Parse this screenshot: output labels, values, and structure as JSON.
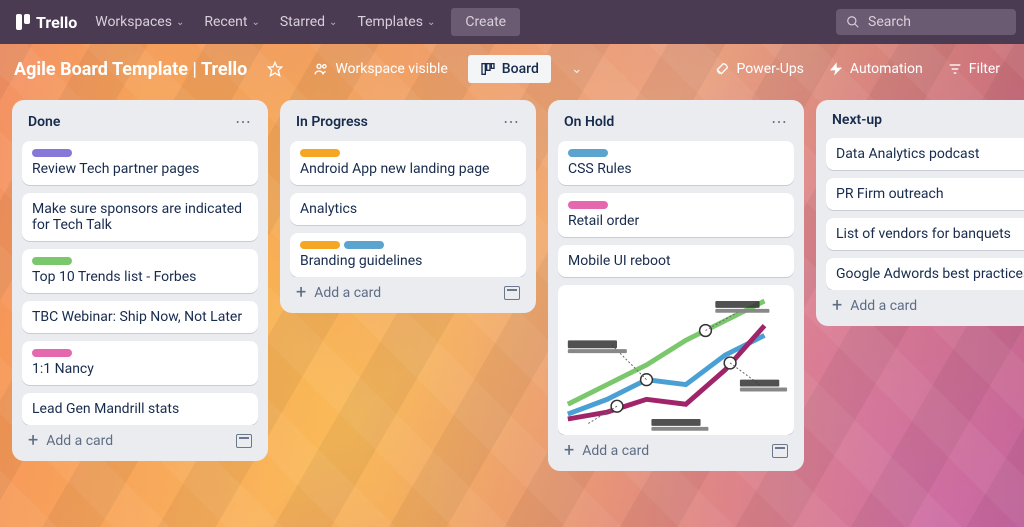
{
  "app": {
    "name": "Trello"
  },
  "topnav": {
    "items": [
      "Workspaces",
      "Recent",
      "Starred",
      "Templates"
    ],
    "create": "Create",
    "search_placeholder": "Search"
  },
  "board": {
    "title": "Agile Board Template | Trello",
    "visibility": "Workspace visible",
    "view_label": "Board",
    "actions": {
      "powerups": "Power-Ups",
      "automation": "Automation",
      "filter": "Filter"
    }
  },
  "lists": [
    {
      "title": "Done",
      "cards": [
        {
          "labels": [
            "#8777d9"
          ],
          "text": "Review Tech partner pages"
        },
        {
          "labels": [],
          "text": "Make sure sponsors are indicated for Tech Talk"
        },
        {
          "labels": [
            "#7bc86c"
          ],
          "text": "Top 10 Trends list - Forbes"
        },
        {
          "labels": [],
          "text": "TBC Webinar: Ship Now, Not Later"
        },
        {
          "labels": [
            "#e568af"
          ],
          "text": "1:1 Nancy"
        },
        {
          "labels": [],
          "text": "Lead Gen Mandrill stats"
        }
      ],
      "add": "Add a card"
    },
    {
      "title": "In Progress",
      "cards": [
        {
          "labels": [
            "#f5a623"
          ],
          "text": "Android App new landing page"
        },
        {
          "labels": [],
          "text": "Analytics"
        },
        {
          "labels": [
            "#f5a623",
            "#5ba4cf"
          ],
          "text": "Branding guidelines"
        }
      ],
      "add": "Add a card"
    },
    {
      "title": "On Hold",
      "cards": [
        {
          "labels": [
            "#5ba4cf"
          ],
          "text": "CSS Rules"
        },
        {
          "labels": [
            "#e568af"
          ],
          "text": "Retail order"
        },
        {
          "labels": [],
          "text": "Mobile UI reboot"
        }
      ],
      "add": "Add a card",
      "has_chart": true
    },
    {
      "title": "Next-up",
      "cards": [
        {
          "labels": [],
          "text": "Data Analytics podcast"
        },
        {
          "labels": [],
          "text": "PR Firm outreach"
        },
        {
          "labels": [],
          "text": "List of vendors for banquets"
        },
        {
          "labels": [],
          "text": "Google Adwords best practices"
        }
      ],
      "add": "Add a card",
      "hide_menu": true
    }
  ],
  "colors": {
    "purple": "#8777d9",
    "green": "#7bc86c",
    "pink": "#e568af",
    "orange": "#f5a623",
    "blue": "#5ba4cf"
  }
}
